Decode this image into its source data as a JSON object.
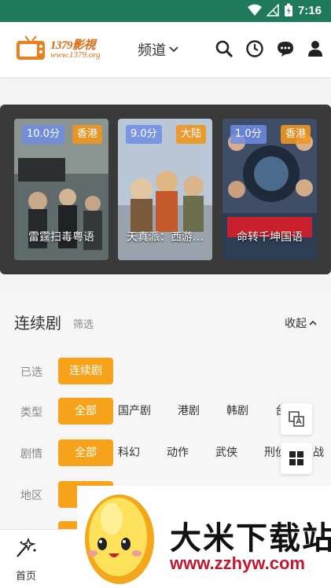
{
  "status_bar": {
    "time": "7:16"
  },
  "header": {
    "logo_text": "1379影視",
    "logo_sub": "www.1379.org",
    "channel_label": "频道"
  },
  "banner": {
    "items": [
      {
        "score": "10.0分",
        "region": "香港",
        "title": "雷霆扫毒粤语"
      },
      {
        "score": "9.0分",
        "region": "大陆",
        "title": "天真派：西游…"
      },
      {
        "score": "1.0分",
        "region": "香港",
        "title": "命转千坤国语"
      }
    ]
  },
  "filter": {
    "title": "连续剧",
    "subtitle": "筛选",
    "collapse_label": "收起",
    "rows": [
      {
        "label": "已选",
        "options": [
          "连续剧"
        ]
      },
      {
        "label": "类型",
        "options": [
          "全部",
          "国产剧",
          "港剧",
          "韩剧",
          "台"
        ]
      },
      {
        "label": "剧情",
        "options": [
          "全部",
          "科幻",
          "动作",
          "武侠",
          "刑侦",
          "战"
        ]
      },
      {
        "label": "地区",
        "options": [
          "全"
        ]
      }
    ]
  },
  "bottom_nav": {
    "items": [
      {
        "label": "首页"
      }
    ]
  },
  "watermark": {
    "title": "大米下载站",
    "url": "www.zzhyw.com"
  },
  "colors": {
    "accent": "#f7a21b",
    "status_bar": "#1e7a5b",
    "banner_bg": "#3a3a3a"
  }
}
